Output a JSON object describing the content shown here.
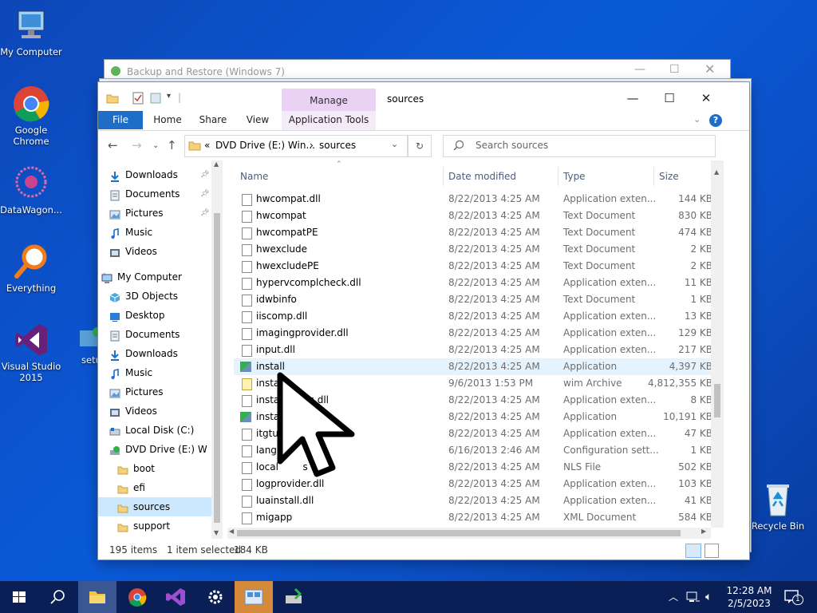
{
  "desktop": {
    "icons": [
      {
        "label": "My Computer"
      },
      {
        "label": "Google Chrome"
      },
      {
        "label": "DataWagon..."
      },
      {
        "label": "Everything"
      },
      {
        "label": "Visual Studio 2015"
      },
      {
        "label": "setu"
      },
      {
        "label": "Recycle Bin"
      }
    ]
  },
  "back_window": {
    "title": "Backup and Restore (Windows 7)"
  },
  "explorer": {
    "contextual_tab": "Manage",
    "title": "sources",
    "ribbon_tabs": [
      "File",
      "Home",
      "Share",
      "View",
      "Application Tools"
    ],
    "breadcrumb": {
      "prefix": "«",
      "parent": "DVD Drive (E:) Win...",
      "sep": "›",
      "current": "sources"
    },
    "search_placeholder": "Search sources",
    "nav": [
      {
        "label": "Downloads",
        "pinned": true
      },
      {
        "label": "Documents",
        "pinned": true
      },
      {
        "label": "Pictures",
        "pinned": true
      },
      {
        "label": "Music"
      },
      {
        "label": "Videos"
      },
      {
        "label": "My Computer"
      },
      {
        "label": "3D Objects"
      },
      {
        "label": "Desktop"
      },
      {
        "label": "Documents"
      },
      {
        "label": "Downloads"
      },
      {
        "label": "Music"
      },
      {
        "label": "Pictures"
      },
      {
        "label": "Videos"
      },
      {
        "label": "Local Disk (C:)"
      },
      {
        "label": "DVD Drive (E:) W"
      },
      {
        "label": "boot"
      },
      {
        "label": "efi"
      },
      {
        "label": "sources",
        "selected": true
      },
      {
        "label": "support"
      }
    ],
    "columns": {
      "name": "Name",
      "date": "Date modified",
      "type": "Type",
      "size": "Size"
    },
    "files": [
      {
        "name": "hwcompat.dll",
        "date": "8/22/2013 4:25 AM",
        "type": "Application exten...",
        "size": "144 KB"
      },
      {
        "name": "hwcompat",
        "date": "8/22/2013 4:25 AM",
        "type": "Text Document",
        "size": "830 KB"
      },
      {
        "name": "hwcompatPE",
        "date": "8/22/2013 4:25 AM",
        "type": "Text Document",
        "size": "474 KB"
      },
      {
        "name": "hwexclude",
        "date": "8/22/2013 4:25 AM",
        "type": "Text Document",
        "size": "2 KB"
      },
      {
        "name": "hwexcludePE",
        "date": "8/22/2013 4:25 AM",
        "type": "Text Document",
        "size": "2 KB"
      },
      {
        "name": "hypervcomplcheck.dll",
        "date": "8/22/2013 4:25 AM",
        "type": "Application exten...",
        "size": "11 KB"
      },
      {
        "name": "idwbinfo",
        "date": "8/22/2013 4:25 AM",
        "type": "Text Document",
        "size": "1 KB"
      },
      {
        "name": "iiscomp.dll",
        "date": "8/22/2013 4:25 AM",
        "type": "Application exten...",
        "size": "13 KB"
      },
      {
        "name": "imagingprovider.dll",
        "date": "8/22/2013 4:25 AM",
        "type": "Application exten...",
        "size": "129 KB"
      },
      {
        "name": "input.dll",
        "date": "8/22/2013 4:25 AM",
        "type": "Application exten...",
        "size": "217 KB"
      },
      {
        "name": "install",
        "date": "8/22/2013 4:25 AM",
        "type": "Application",
        "size": "4,397 KB",
        "selected": true
      },
      {
        "name": "instal",
        "date": "9/6/2013 1:53 PM",
        "type": "wim Archive",
        "size": "4,812,355 KB"
      },
      {
        "name": "instal       es.dll",
        "date": "8/22/2013 4:25 AM",
        "type": "Application exten...",
        "size": "8 KB"
      },
      {
        "name": "instal",
        "date": "8/22/2013 4:25 AM",
        "type": "Application",
        "size": "10,191 KB"
      },
      {
        "name": "itgtup",
        "date": "8/22/2013 4:25 AM",
        "type": "Application exten...",
        "size": "47 KB"
      },
      {
        "name": "lang",
        "date": "6/16/2013 2:46 AM",
        "type": "Configuration sett...",
        "size": "1 KB"
      },
      {
        "name": "local        s",
        "date": "8/22/2013 4:25 AM",
        "type": "NLS File",
        "size": "502 KB"
      },
      {
        "name": "logprovider.dll",
        "date": "8/22/2013 4:25 AM",
        "type": "Application exten...",
        "size": "103 KB"
      },
      {
        "name": "luainstall.dll",
        "date": "8/22/2013 4:25 AM",
        "type": "Application exten...",
        "size": "41 KB"
      },
      {
        "name": "migapp",
        "date": "8/22/2013 4:25 AM",
        "type": "XML Document",
        "size": "584 KB"
      }
    ],
    "status": {
      "count": "195 items",
      "selection": "1 item selected",
      "size": "184 KB"
    }
  },
  "taskbar": {
    "clock_time": "12:28 AM",
    "clock_date": "2/5/2023",
    "notif_count": "1"
  }
}
